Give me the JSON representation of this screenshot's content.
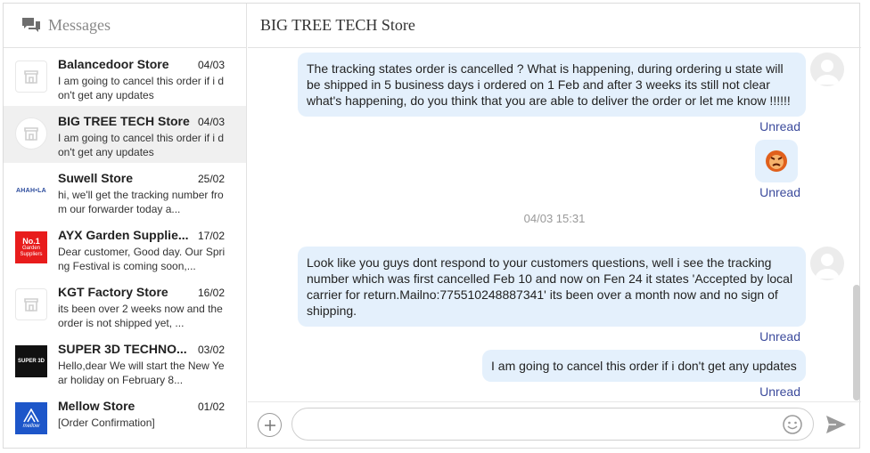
{
  "sidebar": {
    "title": "Messages",
    "icon": "chat-bubbles-icon",
    "conversations": [
      {
        "name": "Balancedoor Store",
        "date": "04/03",
        "preview": "I am going to cancel this order if i don't get any updates",
        "avatar": "store-icon"
      },
      {
        "name": "BIG TREE TECH Store",
        "date": "04/03",
        "preview": "I am going to cancel this order if i don't get any updates",
        "avatar": "store-icon",
        "active": true
      },
      {
        "name": "Suwell Store",
        "date": "25/02",
        "preview": "hi, we'll get the tracking number from our forwarder today a...",
        "avatar_text": "AHAH•LA"
      },
      {
        "name": "AYX Garden Supplie...",
        "date": "17/02",
        "preview": "Dear customer, Good day. Our Spring Festival is coming soon,...",
        "avatar_text": "No.1",
        "avatar_sub": "Garden Suppliers"
      },
      {
        "name": "KGT Factory Store",
        "date": "16/02",
        "preview": "its been over 2 weeks now and the order is not shipped yet, ...",
        "avatar": "store-icon"
      },
      {
        "name": "SUPER 3D TECHNO...",
        "date": "03/02",
        "preview": "Hello,dear We will start the New Year holiday on February 8...",
        "avatar_text": "SUPER 3D"
      },
      {
        "name": "Mellow Store",
        "date": "01/02",
        "preview": "[Order Confirmation]",
        "avatar_text": "mellow"
      }
    ]
  },
  "chat": {
    "title": "BIG TREE TECH Store",
    "messages": [
      {
        "text": "The tracking states order is cancelled ? What is happening, during ordering u state will be shipped in 5 business days i ordered on 1 Feb and after 3 weeks its still not clear what's happening, do you think that you are able to deliver the order or let me know !!!!!!",
        "status": "Unread"
      },
      {
        "sticker": "angry-face-sticker",
        "status": "Unread"
      },
      {
        "text": "Look like you guys dont respond to your customers questions, well i see the tracking number which was first cancelled Feb 10 and now on Fen 24 it states 'Accepted by local carrier for return.Mailno:775510248887341' its been over a month now and no sign of shipping.",
        "status": "Unread"
      },
      {
        "text": "I am going to cancel this order if i don't get any updates",
        "status": "Unread"
      }
    ],
    "timestamp": "04/03 15:31"
  },
  "input": {
    "placeholder": "",
    "value": ""
  },
  "colors": {
    "bubble": "#e4f0fc",
    "unread": "#3c4b9c",
    "active_row": "#f0f0f0"
  }
}
